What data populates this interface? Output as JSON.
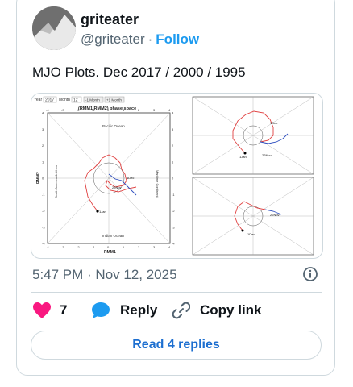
{
  "author": {
    "name": "griteater",
    "handle": "@griteater",
    "follow_label": "Follow",
    "separator": "·"
  },
  "tweet": {
    "text": "MJO Plots.  Dec 2017 / 2000 / 1995"
  },
  "media": {
    "left_plot": {
      "year_label": "Year",
      "year_value": "2017",
      "month_label": "Month",
      "month_value": "12",
      "prev_button": "-1 Month",
      "next_button": "+1 Month",
      "title": "(RMM1,RMM2) phase space",
      "pacific_label": "Pacific Ocean",
      "indian_label": "Indian Ocean",
      "maritime_label": "Maritime Continent",
      "west_label": "South America & Africa",
      "xlabel": "RMM1",
      "ylabel": "RMM2",
      "marker_start": "1Jan",
      "marker_dec": "1Dec",
      "marker_nov": "22Nov",
      "ticks": [
        "-4",
        "-3",
        "-2",
        "-1",
        "0",
        "1",
        "2",
        "3",
        "4"
      ]
    },
    "right_top": {
      "marker_a": "1Dec",
      "marker_b": "22Nov",
      "marker_c": "1Jan"
    },
    "right_bottom": {
      "marker_a": "22Nov",
      "marker_b": "1Dec"
    }
  },
  "meta": {
    "timestamp": "5:47 PM · Nov 12, 2025"
  },
  "actions": {
    "like_count": "7",
    "reply_label": "Reply",
    "copy_label": "Copy link"
  },
  "read_replies": "Read 4 replies",
  "colors": {
    "accent": "#1d9bf0",
    "like": "#f91880",
    "reply_icon": "#1d9bf0"
  }
}
